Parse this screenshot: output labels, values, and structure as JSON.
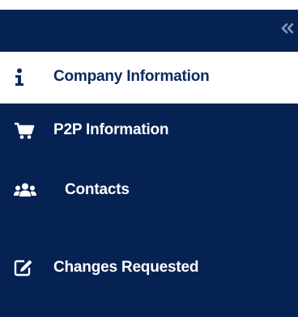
{
  "colors": {
    "sidebar_bg": "#062252",
    "active_bg": "#ffffff",
    "active_text": "#0b2a5e",
    "text": "#ffffff",
    "collapse_icon": "#8a9bb8"
  },
  "sidebar": {
    "collapse_icon": "double-chevron-left-icon",
    "items": [
      {
        "label": "Company Information",
        "icon": "info-icon",
        "active": true
      },
      {
        "label": "P2P Information",
        "icon": "shopping-cart-icon",
        "active": false
      },
      {
        "label": "Contacts",
        "icon": "users-icon",
        "active": false
      },
      {
        "label": "Changes Requested",
        "icon": "edit-icon",
        "active": false
      }
    ]
  }
}
